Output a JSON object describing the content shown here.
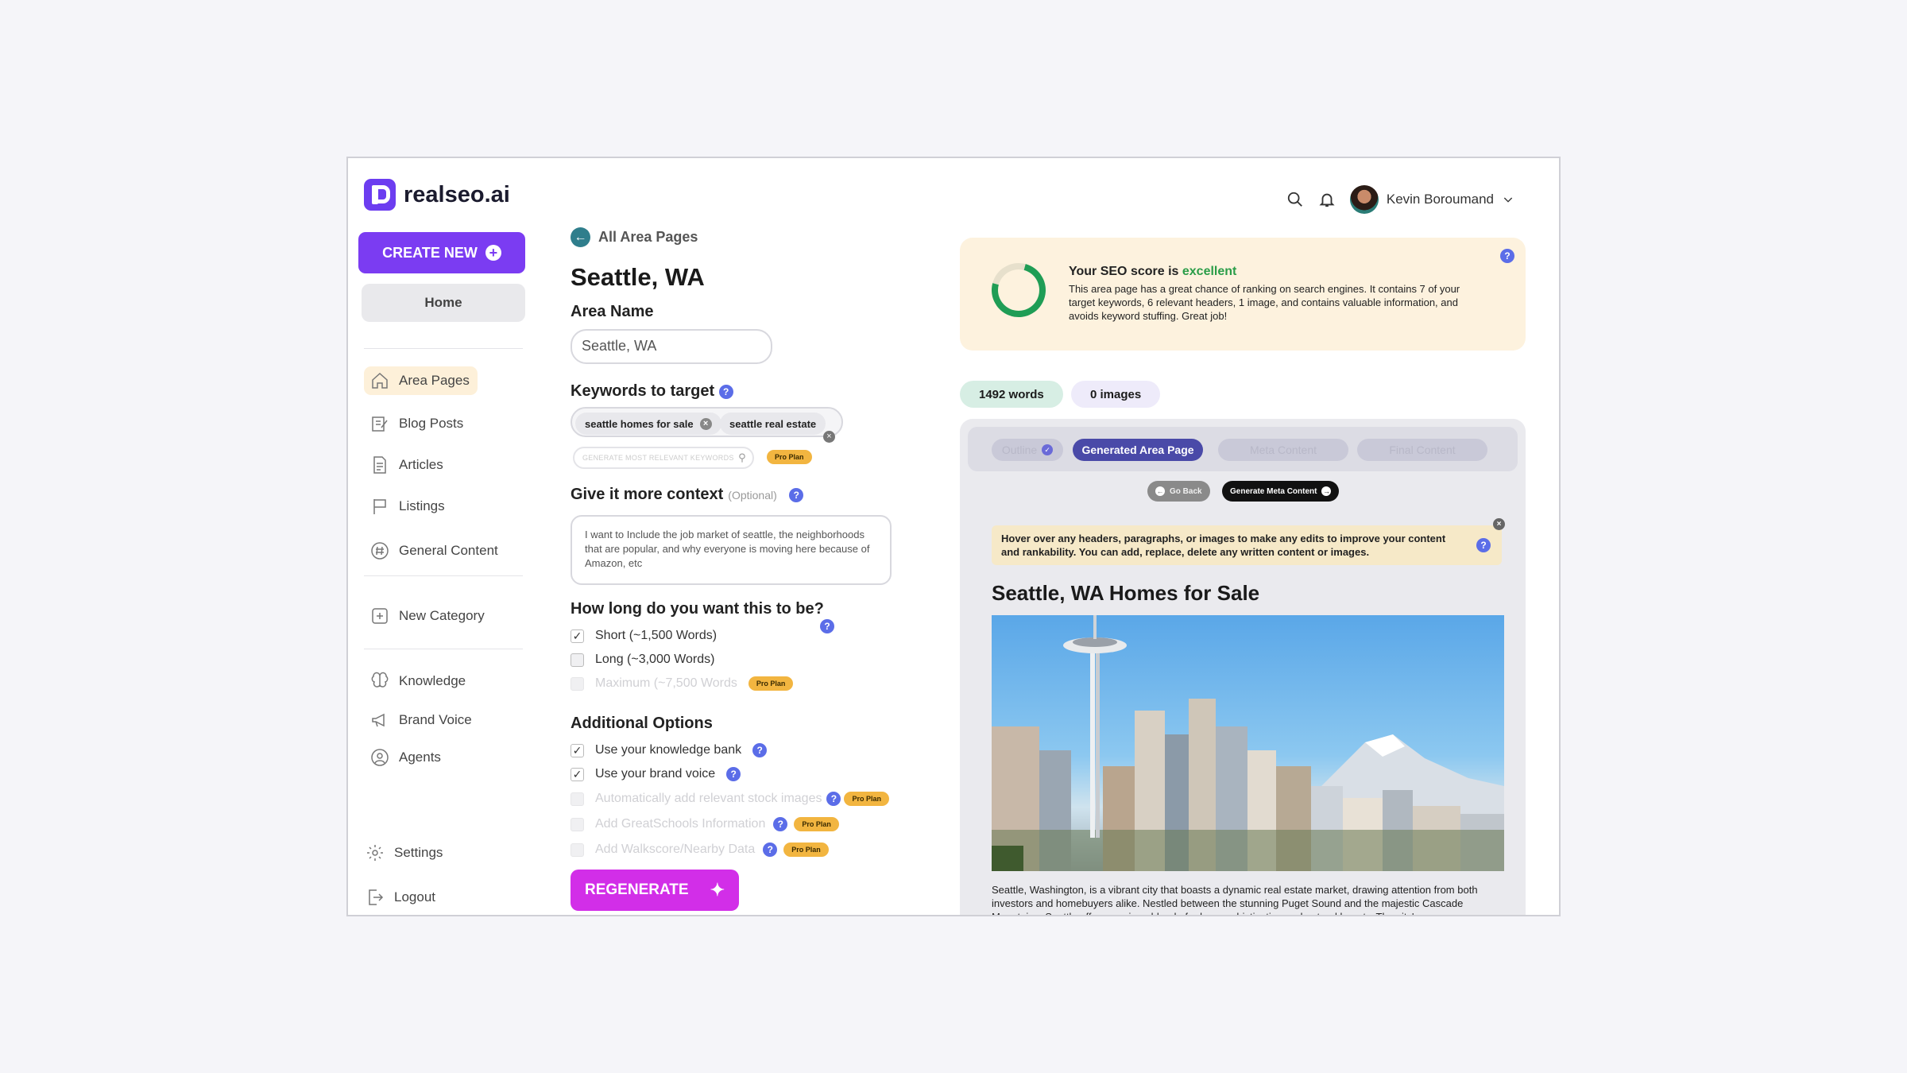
{
  "brand": {
    "name": "realseo.ai",
    "accent": "#7b3cf2"
  },
  "sidebar": {
    "create_label": "CREATE NEW",
    "home_label": "Home",
    "items": [
      {
        "label": "Area Pages",
        "icon": "home-icon"
      },
      {
        "label": "Blog Posts",
        "icon": "edit-icon"
      },
      {
        "label": "Articles",
        "icon": "document-icon"
      },
      {
        "label": "Listings",
        "icon": "flag-icon"
      },
      {
        "label": "General Content",
        "icon": "hash-icon"
      },
      {
        "label": "New Category",
        "icon": "plus-square-icon"
      },
      {
        "label": "Knowledge",
        "icon": "brain-icon"
      },
      {
        "label": "Brand Voice",
        "icon": "megaphone-icon"
      },
      {
        "label": "Agents",
        "icon": "user-circle-icon"
      }
    ],
    "settings_label": "Settings",
    "logout_label": "Logout"
  },
  "header": {
    "user_name": "Kevin Boroumand"
  },
  "form": {
    "back_label": "All Area Pages",
    "page_title": "Seattle, WA",
    "area_name_label": "Area Name",
    "area_name_value": "Seattle, WA",
    "keywords_label": "Keywords to target",
    "keywords": [
      "seattle homes for sale",
      "seattle real estate"
    ],
    "generate_keywords_label": "GENERATE MOST RELEVANT KEYWORDS",
    "pro_label": "Pro Plan",
    "context_label": "Give it more context",
    "context_optional": "(Optional)",
    "context_value": "I want to Include the job market of seattle, the neighborhoods that are popular, and why everyone is moving here because of Amazon, etc",
    "length_label": "How long do you want this to be?",
    "length_options": [
      {
        "label": "Short (~1,500 Words)",
        "checked": true
      },
      {
        "label": "Long (~3,000 Words)",
        "checked": false
      },
      {
        "label": "Maximum (~7,500 Words",
        "checked": false
      }
    ],
    "additional_label": "Additional Options",
    "additional_options": [
      {
        "label": "Use your knowledge bank",
        "checked": true
      },
      {
        "label": "Use your brand voice",
        "checked": true
      },
      {
        "label": "Automatically add relevant stock images",
        "checked": false
      },
      {
        "label": "Add GreatSchools Information",
        "checked": false
      },
      {
        "label": "Add Walkscore/Nearby Data",
        "checked": false
      }
    ],
    "regenerate_label": "REGENERATE"
  },
  "seo": {
    "title_prefix": "Your SEO score is",
    "score_word": "excellent",
    "score_fraction": 0.82,
    "description": "This area page has a great chance of ranking on search engines. It contains 7 of your target keywords, 6 relevant headers, 1 image, and contains valuable information, and avoids keyword stuffing. Great job!"
  },
  "stats": {
    "words": "1492 words",
    "images": "0 images"
  },
  "editor": {
    "tabs": [
      "Outline",
      "Generated Area Page",
      "Meta Content",
      "Final Content"
    ],
    "go_back_label": "Go Back",
    "generate_meta_label": "Generate Meta Content",
    "hint": "Hover over any headers, paragraphs, or images to make any edits to improve your content and rankability. You can add, replace, delete any written content or images.",
    "article_title": "Seattle, WA Homes for Sale",
    "article_body": "Seattle, Washington, is a vibrant city that boasts a dynamic real estate market, drawing attention from both investors and homebuyers alike. Nestled between the stunning Puget Sound and the majestic Cascade Mountains, Seattle offers a unique blend of urban sophistication and natural beauty. The city's"
  }
}
